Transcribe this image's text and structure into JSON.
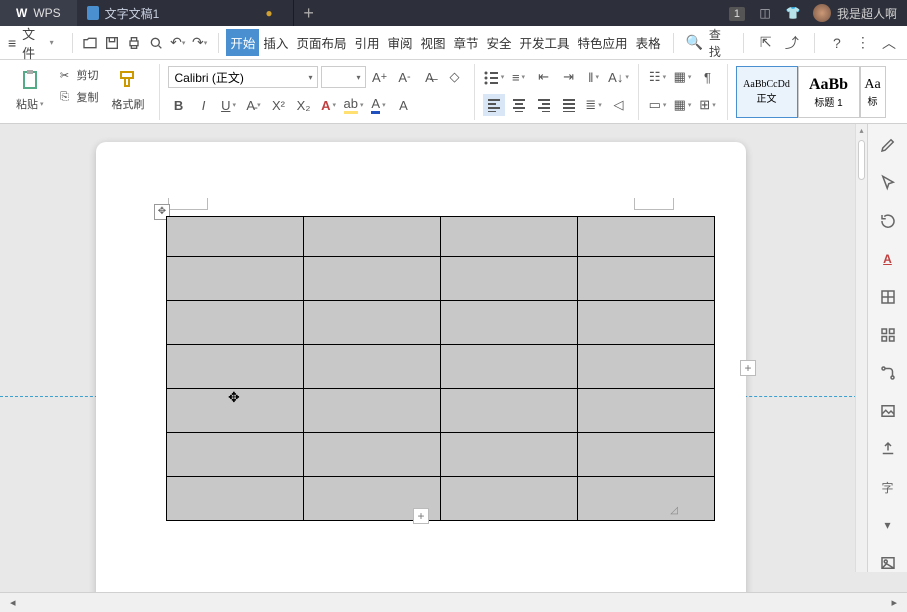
{
  "titlebar": {
    "app": "WPS",
    "doc_title": "文字文稿1",
    "dirty_indicator": "●",
    "new_tab": "+",
    "badge": "1",
    "user": "我是超人啊"
  },
  "menubar": {
    "file": "文件",
    "search": "查找",
    "tabs": [
      "开始",
      "插入",
      "页面布局",
      "引用",
      "审阅",
      "视图",
      "章节",
      "安全",
      "开发工具",
      "特色应用",
      "表格"
    ]
  },
  "toolbar": {
    "paste": "粘贴",
    "cut": "剪切",
    "copy": "复制",
    "format_painter": "格式刷",
    "font_name": "Calibri (正文)",
    "font_size": "",
    "style_body_preview": "AaBbCcDd",
    "style_body_label": "正文",
    "style_h1_preview": "AaBb",
    "style_h1_label": "标题 1",
    "style_h2_preview": "Aa",
    "style_h2_label": "标"
  },
  "sidepanel_icons": [
    "pencil",
    "cursor",
    "rotate",
    "text-a",
    "table",
    "apps",
    "connector",
    "image",
    "share",
    "translate",
    "chevron",
    "picture"
  ],
  "document": {
    "table": {
      "rows": 7,
      "cols": 4
    },
    "add_marker": "+"
  },
  "colors": {
    "accent": "#4a90d0",
    "highlight": "#ffe070",
    "font_color": "#c00000",
    "underline_color": "#2050c0"
  }
}
